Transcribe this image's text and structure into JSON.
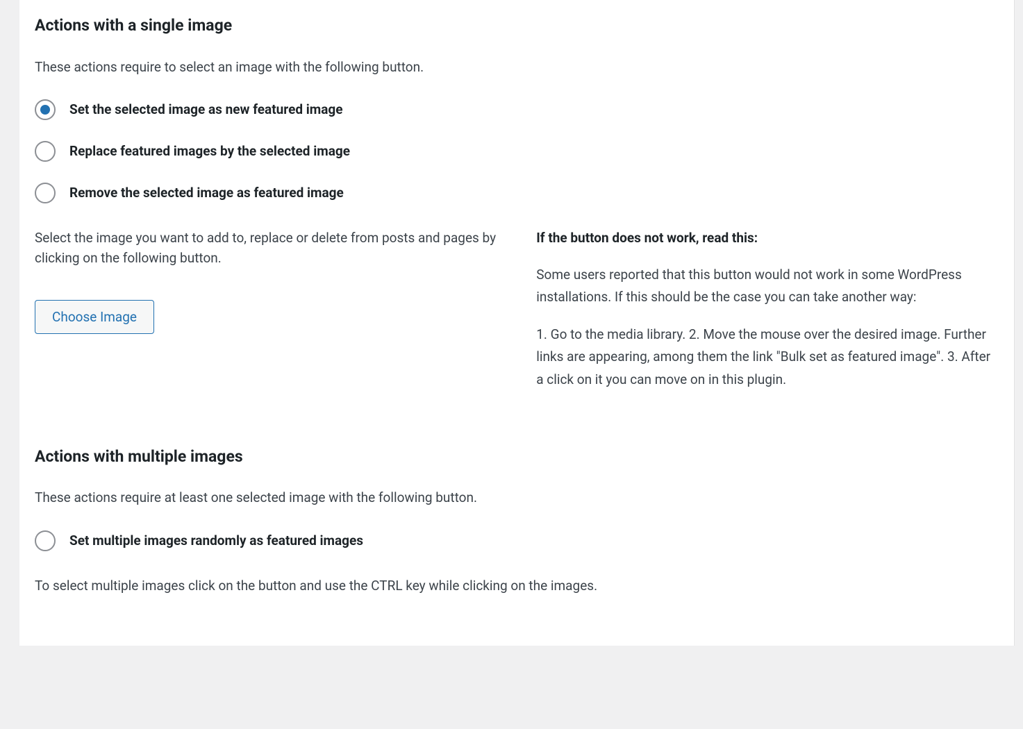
{
  "single": {
    "title": "Actions with a single image",
    "intro": "These actions require to select an image with the following button.",
    "options": {
      "set": "Set the selected image as new featured image",
      "replace": "Replace featured images by the selected image",
      "remove": "Remove the selected image as featured image"
    },
    "selectHelp": "Select the image you want to add to, replace or delete from posts and pages by clicking on the following button.",
    "chooseButton": "Choose Image",
    "troubleshoot": {
      "heading": "If the button does not work, read this:",
      "para1": "Some users reported that this button would not work in some WordPress installations. If this should be the case you can take another way:",
      "para2": "1. Go to the media library. 2. Move the mouse over the desired image. Further links are appearing, among them the link \"Bulk set as featured image\". 3. After a click on it you can move on in this plugin."
    }
  },
  "multiple": {
    "title": "Actions with multiple images",
    "intro": "These actions require at least one selected image with the following button.",
    "options": {
      "random": "Set multiple images randomly as featured images"
    },
    "selectHelp": "To select multiple images click on the button and use the CTRL key while clicking on the images."
  }
}
